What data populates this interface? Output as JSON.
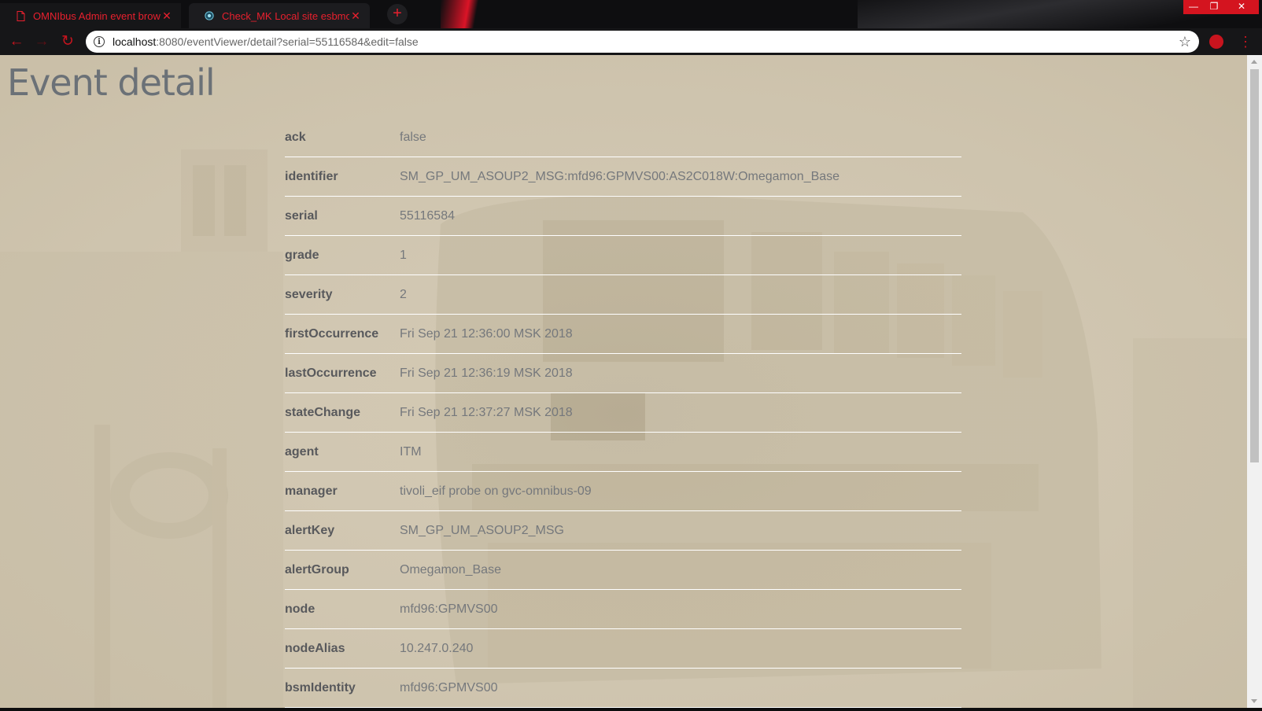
{
  "browser": {
    "tabs": [
      {
        "title": "OMNIbus Admin event browse",
        "icon": "document-icon"
      },
      {
        "title": "Check_MK Local site esbmon",
        "icon": "checkmk-icon"
      }
    ],
    "new_tab": "+",
    "window": {
      "minimize": "—",
      "maximize": "❐",
      "close": "✕"
    },
    "url_host": "localhost",
    "url_rest": ":8080/eventViewer/detail?serial=55116584&edit=false",
    "accent": "#e8202e"
  },
  "page": {
    "title": "Event detail",
    "fields": [
      {
        "key": "ack",
        "value": "false"
      },
      {
        "key": "identifier",
        "value": "SM_GP_UM_ASOUP2_MSG:mfd96:GPMVS00:AS2C018W:Omegamon_Base"
      },
      {
        "key": "serial",
        "value": "55116584"
      },
      {
        "key": "grade",
        "value": "1"
      },
      {
        "key": "severity",
        "value": "2"
      },
      {
        "key": "firstOccurrence",
        "value": "Fri Sep 21 12:36:00 MSK 2018"
      },
      {
        "key": "lastOccurrence",
        "value": "Fri Sep 21 12:36:19 MSK 2018"
      },
      {
        "key": "stateChange",
        "value": "Fri Sep 21 12:37:27 MSK 2018"
      },
      {
        "key": "agent",
        "value": "ITM"
      },
      {
        "key": "manager",
        "value": "tivoli_eif probe on gvc-omnibus-09"
      },
      {
        "key": "alertKey",
        "value": "SM_GP_UM_ASOUP2_MSG"
      },
      {
        "key": "alertGroup",
        "value": "Omegamon_Base"
      },
      {
        "key": "node",
        "value": "mfd96:GPMVS00"
      },
      {
        "key": "nodeAlias",
        "value": "10.247.0.240"
      },
      {
        "key": "bsmIdentity",
        "value": "mfd96:GPMVS00"
      }
    ]
  }
}
